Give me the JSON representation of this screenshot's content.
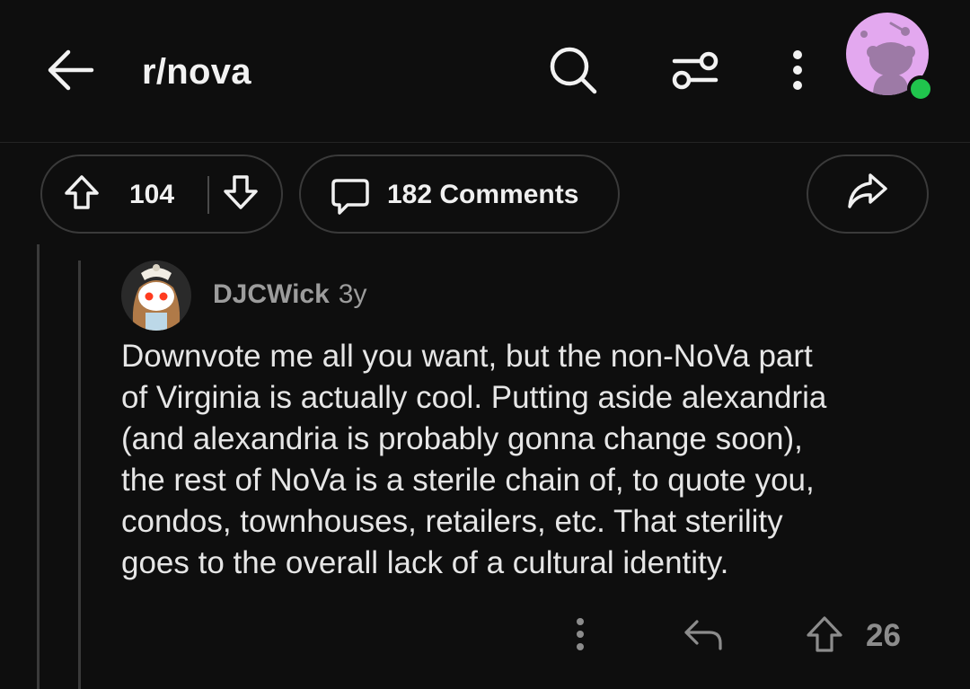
{
  "header": {
    "title": "r/nova",
    "icons": {
      "back": "arrow-left-icon",
      "search": "search-icon",
      "filter": "filter-sliders-icon",
      "more": "more-vertical-icon"
    },
    "avatar_color": "#e3a8ef",
    "online_color": "#20c54d"
  },
  "post_actions": {
    "score": "104",
    "comments_label": "182 Comments",
    "icons": {
      "upvote": "upvote-arrow-icon",
      "downvote": "downvote-arrow-icon",
      "comments": "comment-bubble-icon",
      "share": "share-arrow-icon"
    }
  },
  "comment": {
    "author": "DJCWick",
    "age": "3y",
    "body": "Downvote me all you want, but the non-NoVa part\nof Virginia is actually cool.  Putting aside alexandria\n(and alexandria is probably gonna change soon),\nthe rest of NoVa is a sterile chain of, to quote you,\ncondos, townhouses, retailers, etc.  That sterility\ngoes to the overall lack of a cultural identity.",
    "score": "26",
    "icons": {
      "more": "more-vertical-icon",
      "reply": "reply-arrow-icon",
      "upvote": "upvote-arrow-icon"
    }
  },
  "theme": {
    "background": "#0e0e0e",
    "text": "#e6e6e6",
    "muted": "#9c9c9c",
    "border": "#3a3a3a"
  }
}
